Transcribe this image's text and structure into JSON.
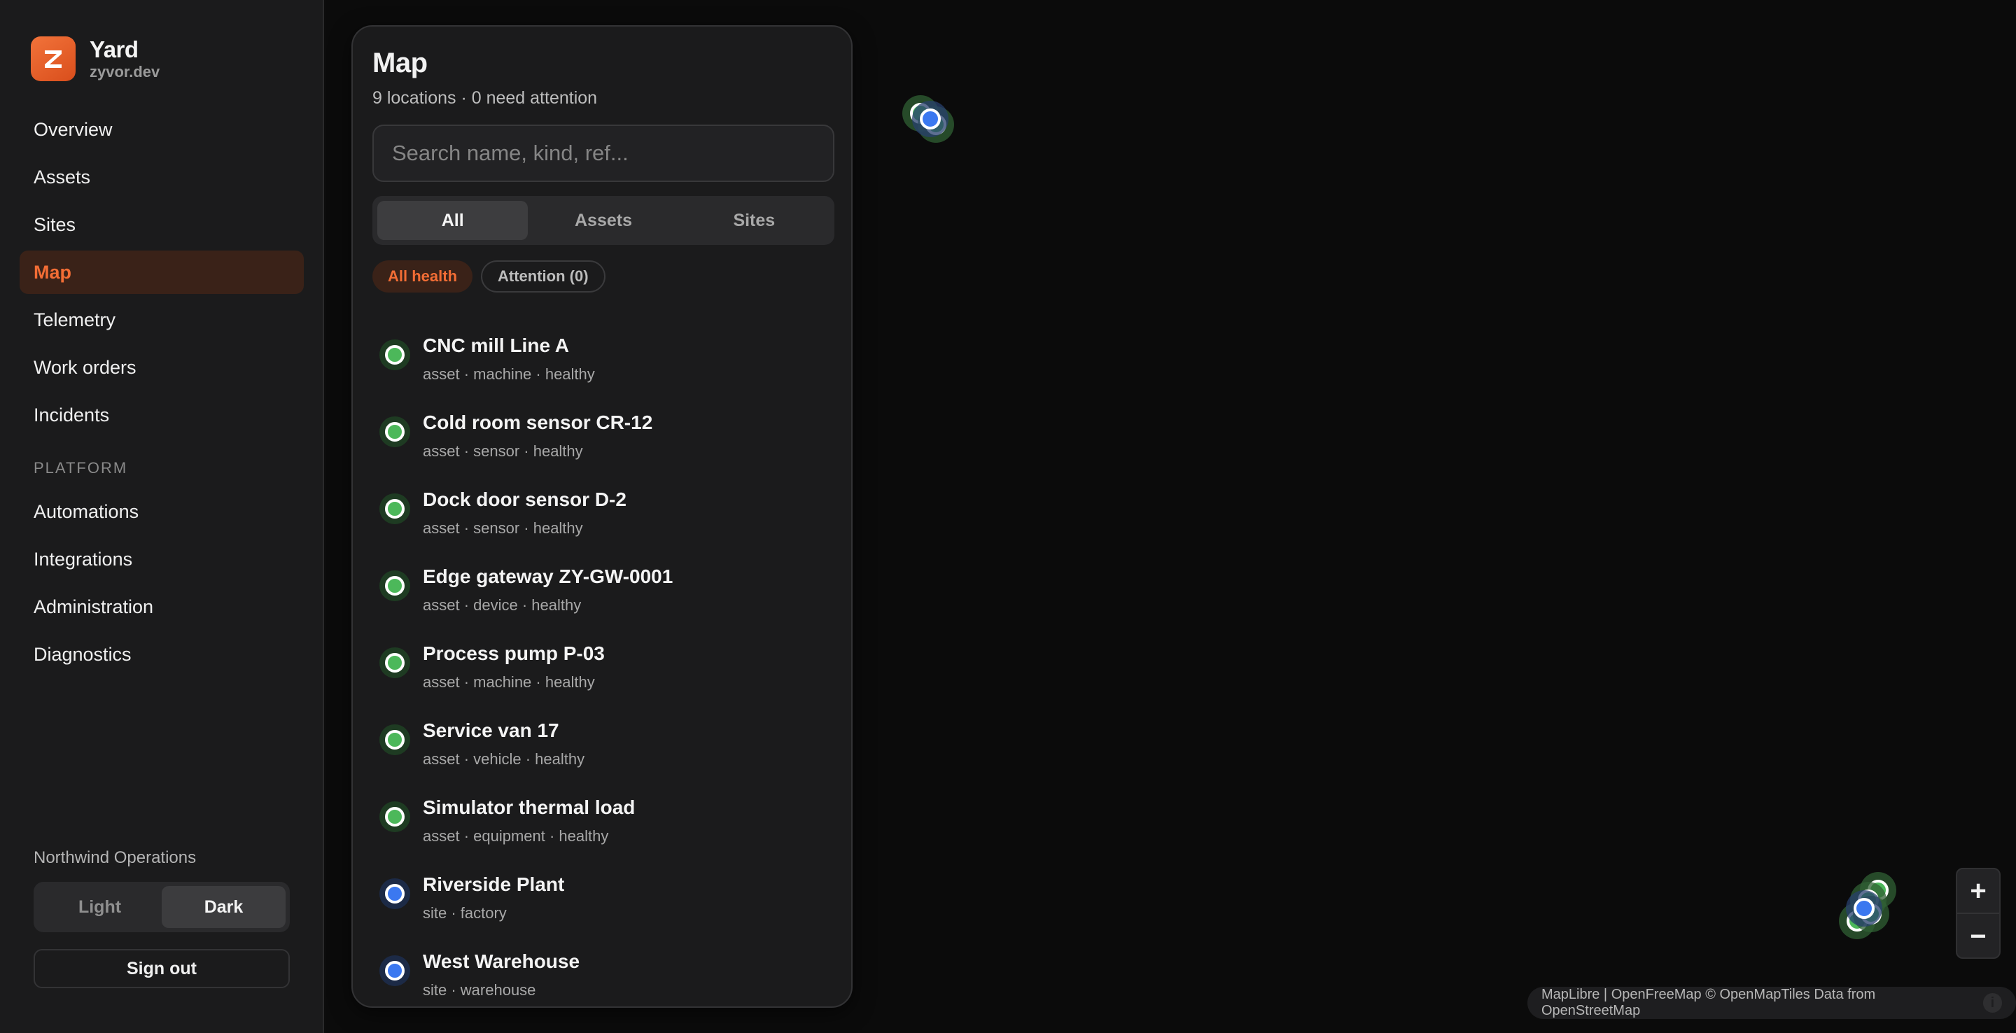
{
  "app": {
    "name": "Yard",
    "domain": "zyvor.dev",
    "logo_letter": "Z"
  },
  "nav": {
    "items": [
      "Overview",
      "Assets",
      "Sites",
      "Map",
      "Telemetry",
      "Work orders",
      "Incidents"
    ],
    "active": "Map",
    "section_label": "PLATFORM",
    "platform_items": [
      "Automations",
      "Integrations",
      "Administration",
      "Diagnostics"
    ]
  },
  "org": "Northwind Operations",
  "theme": {
    "light": "Light",
    "dark": "Dark",
    "selected": "Dark"
  },
  "signout": "Sign out",
  "panel": {
    "title": "Map",
    "subtitle": "9 locations · 0 need attention",
    "search_placeholder": "Search name, kind, ref...",
    "tabs": [
      "All",
      "Assets",
      "Sites"
    ],
    "selected_tab": "All",
    "chips": [
      "All health",
      "Attention (0)"
    ],
    "selected_chip": "All health",
    "items": [
      {
        "title": "CNC mill Line A",
        "meta": "asset · machine · healthy",
        "color": "green"
      },
      {
        "title": "Cold room sensor CR-12",
        "meta": "asset · sensor · healthy",
        "color": "green"
      },
      {
        "title": "Dock door sensor D-2",
        "meta": "asset · sensor · healthy",
        "color": "green"
      },
      {
        "title": "Edge gateway ZY-GW-0001",
        "meta": "asset · device · healthy",
        "color": "green"
      },
      {
        "title": "Process pump P-03",
        "meta": "asset · machine · healthy",
        "color": "green"
      },
      {
        "title": "Service van 17",
        "meta": "asset · vehicle · healthy",
        "color": "green"
      },
      {
        "title": "Simulator thermal load",
        "meta": "asset · equipment · healthy",
        "color": "green"
      },
      {
        "title": "Riverside Plant",
        "meta": "site · factory",
        "color": "blue"
      },
      {
        "title": "West Warehouse",
        "meta": "site · warehouse",
        "color": "blue"
      }
    ]
  },
  "map": {
    "zoom_in": "+",
    "zoom_out": "−",
    "attribution": "MapLibre | OpenFreeMap © OpenMapTiles Data from OpenStreetMap",
    "info_icon": "i"
  },
  "colors": {
    "accent": "#f26d35",
    "healthy": "#4cb85a",
    "site": "#3b78f0"
  }
}
